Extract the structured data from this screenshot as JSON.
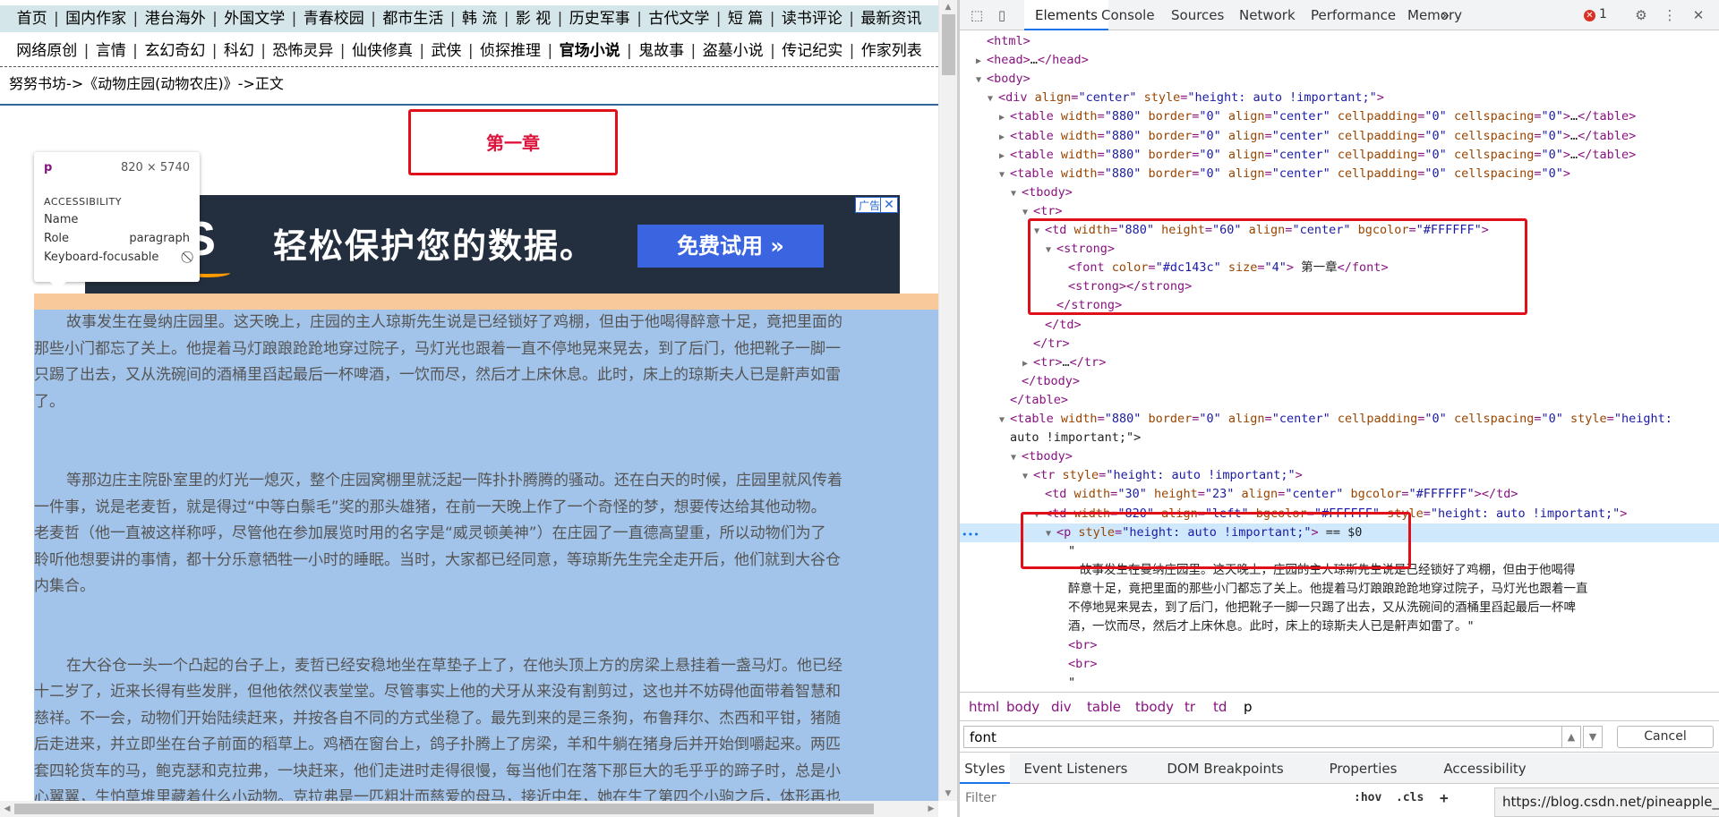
{
  "page": {
    "nav_row1": [
      "首页",
      "国内作家",
      "港台海外",
      "外国文学",
      "青春校园",
      "都市生活",
      "韩 流",
      "影 视",
      "历史军事",
      "古代文学",
      "短 篇",
      "读书评论",
      "最新资讯"
    ],
    "nav_row2": [
      "网络原创",
      "言情",
      "玄幻奇幻",
      "科幻",
      "恐怖灵异",
      "仙侠修真",
      "武侠",
      "侦探推理",
      "官场小说",
      "鬼故事",
      "盗墓小说",
      "传记纪实",
      "作家列表"
    ],
    "breadcrumb": "努努书坊->《动物庄园(动物农庄)》->正文",
    "chapter_title": "第一章",
    "tooltip": {
      "tag": "p",
      "dims": "820 × 5740",
      "section": "ACCESSIBILITY",
      "name_label": "Name",
      "role_label": "Role",
      "role_value": "paragraph",
      "keyboard_label": "Keyboard-focusable"
    },
    "ad": {
      "logo": "S",
      "slogan": "轻松保护您的数据。",
      "cta": "免费试用 »",
      "badge": "广告",
      "close": "✕"
    },
    "paragraphs": [
      [
        "故事发生在曼纳庄园里。这天晚上，庄园的主人琼斯先生说是已经锁好了鸡棚，但由于他喝得醉意十足，竟把里面的",
        "那些小门都忘了关上。他提着马灯踉踉跄跄地穿过院子，马灯光也跟着一直不停地晃来晃去，到了后门，他把靴子一脚一",
        "只踢了出去，又从洗碗间的酒桶里舀起最后一杯啤酒，一饮而尽，然后才上床休息。此时，床上的琼斯夫人已是鼾声如雷",
        "了。"
      ],
      [
        "等那边庄主院卧室里的灯光一熄灭，整个庄园窝棚里就泛起一阵扑扑腾腾的骚动。还在白天的时候，庄园里就风传着",
        "一件事，说是老麦哲，就是得过“中等白鬃毛”奖的那头雄猪，在前一天晚上作了一个奇怪的梦，想要传达给其他动物。",
        "老麦哲（他一直被这样称呼，尽管他在参加展览时用的名字是“威灵顿美神”）在庄园了一直德高望重，所以动物们为了",
        "聆听他想要讲的事情，都十分乐意牺牲一小时的睡眠。当时，大家都已经同意，等琼斯先生完全走开后，他们就到大谷仓",
        "内集合。"
      ],
      [
        "在大谷仓一头一个凸起的台子上，麦哲已经安稳地坐在草垫子上了，在他头顶上方的房梁上悬挂着一盏马灯。他已经",
        "十二岁了，近来长得有些发胖，但他依然仪表堂堂。尽管事实上他的犬牙从来没有割剪过，这也并不妨碍他面带着智慧和",
        "慈祥。不一会，动物们开始陆续赶来，并按各自不同的方式坐稳了。最先到来的是三条狗，布鲁拜尔、杰西和平钳，猪随",
        "后走进来，并立即坐在台子前面的稻草上。鸡栖在窗台上，鸽子扑腾上了房梁，羊和牛躺在猪身后并开始倒嚼起来。两匹",
        "套四轮货车的马，鲍克瑟和克拉弗，一块赶来，他们走进时走得很慢，每当他们在落下那巨大的毛乎乎的蹄子时，总是小",
        "心翼翼，生怕草堆里藏着什么小动物。克拉弗是一匹粗壮而慈爱的母马，接近中年，她在生了第四个小驹之后，体形再也"
      ]
    ]
  },
  "devtools": {
    "tabs": [
      "Elements",
      "Console",
      "Sources",
      "Network",
      "Performance",
      "Memory"
    ],
    "more": "»",
    "error_count": "1",
    "tree": [
      {
        "indent": 0,
        "tri": "",
        "html": "<html>"
      },
      {
        "indent": 0,
        "tri": "▶",
        "html": "<head>…</head>"
      },
      {
        "indent": 0,
        "tri": "▼",
        "html": "<body>"
      },
      {
        "indent": 1,
        "tri": "▼",
        "html": "<div align=\"center\" style=\"height: auto !important;\">"
      },
      {
        "indent": 2,
        "tri": "▶",
        "html": "<table width=\"880\" border=\"0\" align=\"center\" cellpadding=\"0\" cellspacing=\"0\">…</table>"
      },
      {
        "indent": 2,
        "tri": "▶",
        "html": "<table width=\"880\" border=\"0\" align=\"center\" cellpadding=\"0\" cellspacing=\"0\">…</table>"
      },
      {
        "indent": 2,
        "tri": "▶",
        "html": "<table width=\"880\" border=\"0\" align=\"center\" cellpadding=\"0\" cellspacing=\"0\">…</table>"
      },
      {
        "indent": 2,
        "tri": "▼",
        "html": "<table width=\"880\" border=\"0\" align=\"center\" cellpadding=\"0\" cellspacing=\"0\">"
      },
      {
        "indent": 3,
        "tri": "▼",
        "html": "<tbody>"
      },
      {
        "indent": 4,
        "tri": "▼",
        "html": "<tr>"
      },
      {
        "indent": 5,
        "tri": "▼",
        "html": "<td width=\"880\" height=\"60\" align=\"center\" bgcolor=\"#FFFFFF\">"
      },
      {
        "indent": 6,
        "tri": "▼",
        "html": "<strong>"
      },
      {
        "indent": 7,
        "tri": "",
        "html": "<font color=\"#dc143c\" size=\"4\"> 第一章</font>"
      },
      {
        "indent": 7,
        "tri": "",
        "html": "<strong></strong>"
      },
      {
        "indent": 6,
        "tri": "",
        "html": "</strong>"
      },
      {
        "indent": 5,
        "tri": "",
        "html": "</td>"
      },
      {
        "indent": 4,
        "tri": "",
        "html": "</tr>"
      },
      {
        "indent": 4,
        "tri": "▶",
        "html": "<tr>…</tr>"
      },
      {
        "indent": 3,
        "tri": "",
        "html": "</tbody>"
      },
      {
        "indent": 2,
        "tri": "",
        "html": "</table>"
      },
      {
        "indent": 2,
        "tri": "▼",
        "html": "<table width=\"880\" border=\"0\" align=\"center\" cellpadding=\"0\" cellspacing=\"0\" style=\"height:"
      },
      {
        "indent": 2,
        "tri": "",
        "html": "auto !important;\">"
      },
      {
        "indent": 3,
        "tri": "▼",
        "html": "<tbody>"
      },
      {
        "indent": 4,
        "tri": "▼",
        "html": "<tr style=\"height: auto !important;\">"
      },
      {
        "indent": 5,
        "tri": "",
        "html": "<td width=\"30\" height=\"23\" align=\"center\" bgcolor=\"#FFFFFF\"></td>"
      },
      {
        "indent": 5,
        "tri": "▼",
        "html": "<td width=\"820\" align=\"left\" bgcolor=\"#FFFFFF\" style=\"height: auto !important;\">"
      },
      {
        "indent": 6,
        "tri": "▼",
        "html": "<p style=\"height: auto !important;\"> == $0",
        "sel": true
      },
      {
        "indent": 7,
        "tri": "",
        "html": "\""
      },
      {
        "indent": 8,
        "tri": "",
        "html": "故事发生在曼纳庄园里。这天晚上，庄园的主人琼斯先生说是已经锁好了鸡棚，但由于他喝得",
        "text": true
      },
      {
        "indent": 7,
        "tri": "",
        "html": "醉意十足，竟把里面的那些小门都忘了关上。他提着马灯踉踉跄跄地穿过院子，马灯光也跟着一直",
        "text": true
      },
      {
        "indent": 7,
        "tri": "",
        "html": "不停地晃来晃去，到了后门，他把靴子一脚一只踢了出去，又从洗碗间的酒桶里舀起最后一杯啤",
        "text": true
      },
      {
        "indent": 7,
        "tri": "",
        "html": "酒，一饮而尽，然后才上床休息。此时，床上的琼斯夫人已是鼾声如雷了。\"",
        "text": true
      },
      {
        "indent": 7,
        "tri": "",
        "html": "<br>"
      },
      {
        "indent": 7,
        "tri": "",
        "html": "<br>"
      },
      {
        "indent": 7,
        "tri": "",
        "html": "\""
      }
    ],
    "crumbs": [
      "html",
      "body",
      "div",
      "table",
      "tbody",
      "tr",
      "td",
      "p"
    ],
    "search_value": "font",
    "cancel_label": "Cancel",
    "style_tabs": [
      "Styles",
      "Event Listeners",
      "DOM Breakpoints",
      "Properties",
      "Accessibility"
    ],
    "filter_placeholder": "Filter",
    "hov": ":hov",
    "cls": ".cls",
    "plus": "+",
    "url": "https://blog.csdn.net/pineapple_C"
  }
}
